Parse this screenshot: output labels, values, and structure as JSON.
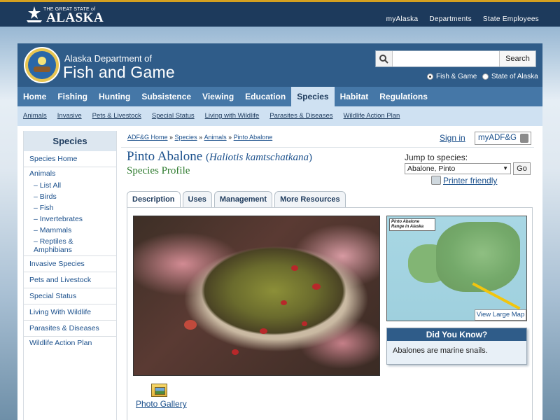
{
  "state_bar": {
    "logo_small": "THE GREAT STATE of",
    "logo_big": "ALASKA",
    "nav": [
      "myAlaska",
      "Departments",
      "State Employees"
    ]
  },
  "header": {
    "dept_line1": "Alaska Department of",
    "dept_line2": "Fish and Game",
    "search_placeholder": "",
    "search_button": "Search",
    "scope_options": [
      "Fish & Game",
      "State of Alaska"
    ],
    "scope_selected": "Fish & Game"
  },
  "main_nav": {
    "items": [
      "Home",
      "Fishing",
      "Hunting",
      "Subsistence",
      "Viewing",
      "Education",
      "Species",
      "Habitat",
      "Regulations"
    ],
    "active": "Species"
  },
  "sub_nav": [
    "Animals",
    "Invasive",
    "Pets & Livestock",
    "Special Status",
    "Living with Wildlife",
    "Parasites & Diseases",
    "Wildlife Action Plan"
  ],
  "sidebar": {
    "title": "Species",
    "items": [
      {
        "label": "Species Home",
        "type": "sep"
      },
      {
        "label": "Animals",
        "type": "top"
      },
      {
        "label": "List All",
        "type": "sub"
      },
      {
        "label": "Birds",
        "type": "sub"
      },
      {
        "label": "Fish",
        "type": "sub"
      },
      {
        "label": "Invertebrates",
        "type": "sub"
      },
      {
        "label": "Mammals",
        "type": "sub"
      },
      {
        "label": "Reptiles & Amphibians",
        "type": "sub-sep"
      },
      {
        "label": "Invasive Species",
        "type": "sep"
      },
      {
        "label": "Pets and Livestock",
        "type": "sep"
      },
      {
        "label": "Special Status",
        "type": "sep"
      },
      {
        "label": "Living With Wildlife",
        "type": "sep"
      },
      {
        "label": "Parasites & Diseases",
        "type": "sep"
      },
      {
        "label": "Wildlife Action Plan",
        "type": "top"
      }
    ]
  },
  "breadcrumb": [
    "ADF&G Home",
    "Species",
    "Animals",
    "Pinto Abalone"
  ],
  "account": {
    "sign_in": "Sign in",
    "my_adfg": "myADF&G"
  },
  "title": {
    "common": "Pinto Abalone",
    "scientific": "Haliotis kamtschatkana",
    "subtitle": "Species Profile"
  },
  "jump": {
    "label": "Jump to species:",
    "selected": "Abalone, Pinto",
    "go": "Go",
    "printer": "Printer friendly"
  },
  "tabs": {
    "items": [
      "Description",
      "Uses",
      "Management",
      "More Resources"
    ],
    "active": "Description"
  },
  "map": {
    "label": "Pinto Abalone Range in Alaska",
    "view_large": "View Large Map"
  },
  "did_you_know": {
    "title": "Did You Know?",
    "text": "Abalones are marine snails."
  },
  "gallery": {
    "label": "Photo Gallery"
  }
}
